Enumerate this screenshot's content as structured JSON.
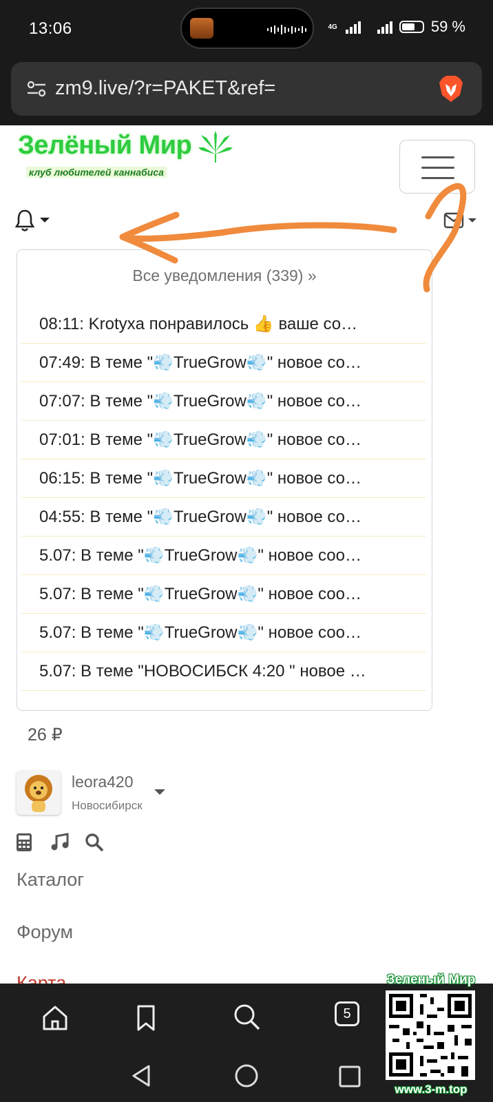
{
  "status_bar": {
    "time": "13:06",
    "network": "4G",
    "battery": "59 %"
  },
  "browser": {
    "url": "zm9.live/?r=PAKET&ref=",
    "tabs_count": "5"
  },
  "site": {
    "logo_title": "Зелёный Мир",
    "logo_subtitle": "клуб любителей каннабиса",
    "accent_color": "#2ecc40"
  },
  "notifications": {
    "all_label": "Все уведомления (339) »",
    "items": [
      {
        "text": "08:11: Krotyxa понравилось 👍 ваше со…"
      },
      {
        "text": "07:49: В теме \"💨TrueGrow💨\" новое со…"
      },
      {
        "text": "07:07: В теме \"💨TrueGrow💨\" новое со…"
      },
      {
        "text": "07:01: В теме \"💨TrueGrow💨\" новое со…"
      },
      {
        "text": "06:15: В теме \"💨TrueGrow💨\" новое со…"
      },
      {
        "text": "04:55: В теме \"💨TrueGrow💨\" новое со…"
      },
      {
        "text": "5.07: В теме \"💨TrueGrow💨\" новое соо…"
      },
      {
        "text": "5.07: В теме \"💨TrueGrow💨\" новое соо…"
      },
      {
        "text": "5.07: В теме \"💨TrueGrow💨\" новое соо…"
      },
      {
        "text": "5.07: В теме \"НОВОСИБСК 4:20 \" новое …"
      }
    ]
  },
  "balance": "26 ₽",
  "user": {
    "name": "leora420",
    "city": "Новосибирск"
  },
  "nav": {
    "catalog": "Каталог",
    "forum": "Форум",
    "map": "Карта"
  },
  "watermark": {
    "title": "Зеленый Мир",
    "url": "www.3-m.top"
  }
}
